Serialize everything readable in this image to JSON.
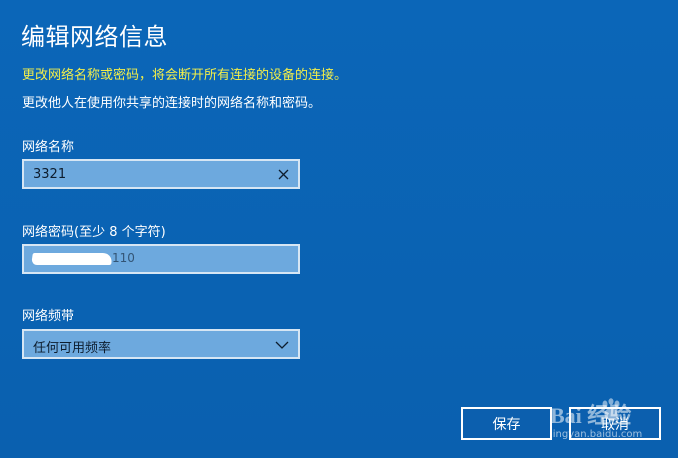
{
  "dialog": {
    "title": "编辑网络信息",
    "warning": "更改网络名称或密码，将会断开所有连接的设备的连接。",
    "info": "更改他人在使用你共享的连接时的网络名称和密码。"
  },
  "network_name": {
    "label": "网络名称",
    "value": "3321"
  },
  "password": {
    "label": "网络密码(至少 8 个字符)",
    "partial_visible": "110"
  },
  "band": {
    "label": "网络频带",
    "selected": "任何可用频率"
  },
  "buttons": {
    "save": "保存",
    "cancel": "取消"
  },
  "watermark": {
    "text": "Bai  经验",
    "sub": "jingyan.baidu.com"
  },
  "colors": {
    "background": "#0a63b5",
    "warning_text": "#f2ee4a",
    "field_bg": "#6da9de"
  },
  "icons": {
    "clear": "close-icon",
    "dropdown": "chevron-down-icon"
  }
}
